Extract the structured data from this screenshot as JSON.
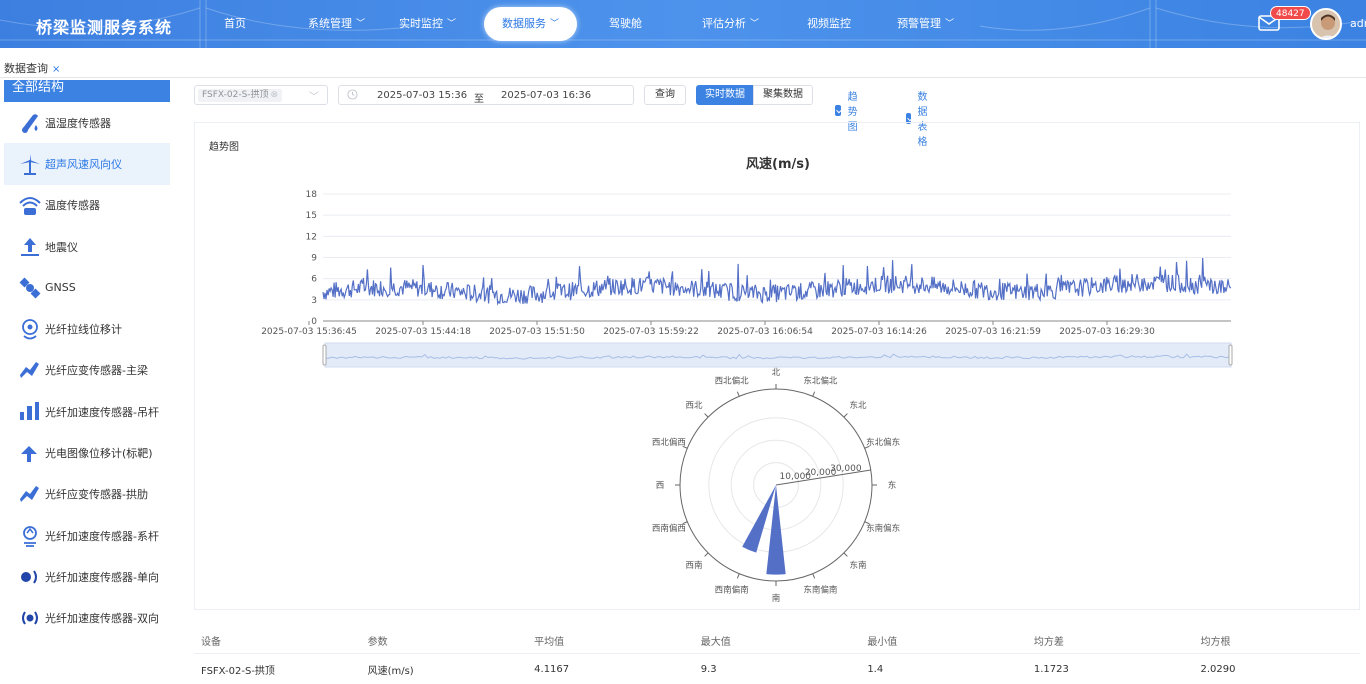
{
  "header": {
    "app_title": "桥梁监测服务系统",
    "nav": [
      {
        "label": "首页",
        "has_dropdown": false,
        "active": false
      },
      {
        "label": "系统管理",
        "has_dropdown": true,
        "active": false
      },
      {
        "label": "实时监控",
        "has_dropdown": true,
        "active": false
      },
      {
        "label": "数据服务",
        "has_dropdown": true,
        "active": true
      },
      {
        "label": "驾驶舱",
        "has_dropdown": false,
        "active": false
      },
      {
        "label": "评估分析",
        "has_dropdown": true,
        "active": false
      },
      {
        "label": "视频监控",
        "has_dropdown": false,
        "active": false
      },
      {
        "label": "预警管理",
        "has_dropdown": true,
        "active": false
      }
    ],
    "badge_count": "48427",
    "user_name": "admin",
    "icons": {
      "mail": "mail-icon",
      "avatar": "user-avatar"
    }
  },
  "tabs": {
    "current": "数据查询",
    "close": "×"
  },
  "sidebar": {
    "heading": "全部结构",
    "items": [
      {
        "label": "温湿度传感器",
        "icon": "thermometer-droplet-icon",
        "active": false
      },
      {
        "label": "超声风速风向仪",
        "icon": "wind-turbine-icon",
        "active": true
      },
      {
        "label": "温度传感器",
        "icon": "temperature-wifi-icon",
        "active": false
      },
      {
        "label": "地震仪",
        "icon": "seismometer-icon",
        "active": false
      },
      {
        "label": "GNSS",
        "icon": "satellite-icon",
        "active": false
      },
      {
        "label": "光纤拉线位移计",
        "icon": "displacement-icon",
        "active": false
      },
      {
        "label": "光纤应变传感器-主梁",
        "icon": "strain-sensor-icon",
        "active": false
      },
      {
        "label": "光纤加速度传感器-吊杆",
        "icon": "accelerometer-bars-icon",
        "active": false
      },
      {
        "label": "光电图像位移计(标靶)",
        "icon": "target-displacement-icon",
        "active": false
      },
      {
        "label": "光纤应变传感器-拱肋",
        "icon": "strain-sensor-icon",
        "active": false
      },
      {
        "label": "光纤加速度传感器-系杆",
        "icon": "location-sensor-icon",
        "active": false
      },
      {
        "label": "光纤加速度传感器-单向",
        "icon": "signal-one-way-icon",
        "active": false
      },
      {
        "label": "光纤加速度传感器-双向",
        "icon": "signal-two-way-icon",
        "active": false
      }
    ]
  },
  "toolbar": {
    "device_tag": "FSFX-02-S-拱顶",
    "date_start": "2025-07-03 15:36",
    "date_sep": "至",
    "date_end": "2025-07-03 16:36",
    "query_label": "查询",
    "realtime_label": "实时数据",
    "aggregate_label": "聚集数据",
    "trend_label": "趋势图",
    "trend_checked": true,
    "table_label": "数据表格",
    "table_checked": true
  },
  "chart": {
    "panel_title": "趋势图",
    "title": "风速(m/s)"
  },
  "chart_data": [
    {
      "type": "line",
      "title": "风速(m/s)",
      "yticks": [
        0,
        3,
        6,
        9,
        12,
        15,
        18
      ],
      "ylim": [
        0,
        18
      ],
      "xticks": [
        "2025-07-03 15:36:45",
        "2025-07-03 15:44:18",
        "2025-07-03 15:51:50",
        "2025-07-03 15:59:22",
        "2025-07-03 16:06:54",
        "2025-07-03 16:14:26",
        "2025-07-03 16:21:59",
        "2025-07-03 16:29:30"
      ],
      "series": [
        {
          "mean": 4.1167,
          "max": 9.3,
          "min": 1.4,
          "std": 1.1723,
          "rms": 2.029
        }
      ],
      "grid": true,
      "color": "#5470c6",
      "datazoom": true
    },
    {
      "type": "polar-bar",
      "radial_ticks": [
        "10,000",
        "20,000",
        "30,000"
      ],
      "directions": [
        "北",
        "东北偏北",
        "东北",
        "东北偏东",
        "东",
        "东南偏东",
        "东南",
        "东南偏南",
        "南",
        "西南偏南",
        "西南",
        "西南偏西",
        "西",
        "西北偏西",
        "西北",
        "西北偏北"
      ],
      "values": [
        0,
        0,
        0,
        0,
        0,
        0,
        0,
        0,
        28000,
        22000,
        0,
        0,
        0,
        0,
        0,
        0
      ],
      "rmax": 30000,
      "color": "#5470c6"
    }
  ],
  "table": {
    "headers": [
      "设备",
      "参数",
      "平均值",
      "最大值",
      "最小值",
      "均方差",
      "均方根"
    ],
    "rows": [
      [
        "FSFX-02-S-拱顶",
        "风速(m/s)",
        "4.1167",
        "9.3",
        "1.4",
        "1.1723",
        "2.0290"
      ]
    ]
  }
}
